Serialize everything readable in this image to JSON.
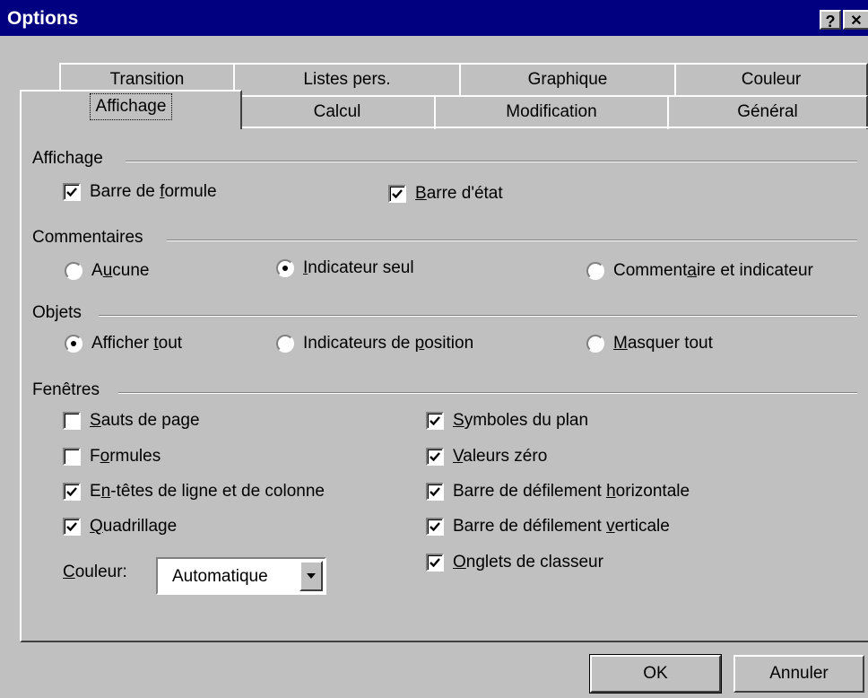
{
  "window": {
    "title": "Options",
    "help_label": "?",
    "close_label": "✕"
  },
  "tabs": {
    "back_row": [
      "Transition",
      "Listes pers.",
      "Graphique",
      "Couleur"
    ],
    "front_row": [
      "Affichage",
      "Calcul",
      "Modification",
      "Général"
    ],
    "active": "Affichage"
  },
  "groups": {
    "affichage": {
      "label": "Affichage",
      "barre_formule": {
        "pre": "Barre de ",
        "u": "f",
        "post": "ormule",
        "checked": true
      },
      "barre_etat": {
        "pre": "",
        "u": "B",
        "post": "arre d'état",
        "checked": true
      }
    },
    "commentaires": {
      "label": "Commentaires",
      "aucune": {
        "pre": "A",
        "u": "u",
        "post": "cune",
        "selected": false
      },
      "indicateur_seul": {
        "pre": "",
        "u": "I",
        "post": "ndicateur seul",
        "selected": true
      },
      "commentaire_indicateur": {
        "pre": "Comment",
        "u": "a",
        "post": "ire et indicateur",
        "selected": false
      }
    },
    "objets": {
      "label": "Objets",
      "afficher_tout": {
        "pre": "Afficher ",
        "u": "t",
        "post": "out",
        "selected": true
      },
      "indicateurs_position": {
        "pre": "Indicateurs de ",
        "u": "p",
        "post": "osition",
        "selected": false
      },
      "masquer_tout": {
        "pre": "",
        "u": "M",
        "post": "asquer tout",
        "selected": false
      }
    },
    "fenetres": {
      "label": "Fenêtres",
      "sauts_page": {
        "pre": "",
        "u": "S",
        "post": "auts de page",
        "checked": false
      },
      "formules": {
        "pre": "F",
        "u": "o",
        "post": "rmules",
        "checked": false
      },
      "entetes": {
        "pre": "E",
        "u": "n",
        "post": "-têtes de ligne et de colonne",
        "checked": true
      },
      "quadrillage": {
        "pre": "",
        "u": "Q",
        "post": "uadrillage",
        "checked": true
      },
      "symboles_plan": {
        "pre": "",
        "u": "S",
        "post": "ymboles du plan",
        "checked": true
      },
      "valeurs_zero": {
        "pre": "",
        "u": "V",
        "post": "aleurs zéro",
        "checked": true
      },
      "defil_horizontale": {
        "pre": "Barre de défilement ",
        "u": "h",
        "post": "orizontale",
        "checked": true
      },
      "defil_verticale": {
        "pre": "Barre de défilement ",
        "u": "v",
        "post": "erticale",
        "checked": true
      },
      "onglets": {
        "pre": "",
        "u": "O",
        "post": "nglets de classeur",
        "checked": true
      },
      "couleur_label": {
        "pre": "",
        "u": "C",
        "post": "ouleur:"
      },
      "couleur_value": "Automatique"
    }
  },
  "buttons": {
    "ok": "OK",
    "annuler": "Annuler"
  }
}
